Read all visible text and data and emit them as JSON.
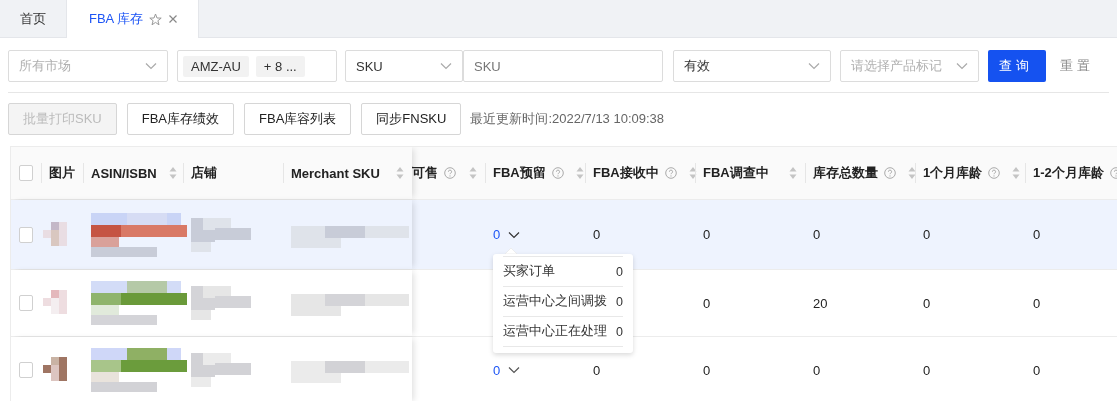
{
  "tabs": [
    {
      "label": "首页",
      "selected": false,
      "closable": false
    },
    {
      "label": "FBA 库存",
      "selected": true,
      "closable": true
    }
  ],
  "filters": [
    {
      "kind": "select",
      "placeholder": "所有市场"
    },
    {
      "kind": "tags",
      "tags": [
        "AMZ-AU",
        "+ 8 ..."
      ]
    },
    {
      "kind": "select",
      "value": "SKU"
    },
    {
      "kind": "input",
      "placeholder": "SKU"
    },
    {
      "kind": "select",
      "value": "有效"
    },
    {
      "kind": "select",
      "placeholder": "请选择产品标记"
    }
  ],
  "search_button": "查询",
  "reset_button": "重置",
  "actions": [
    {
      "label": "批量打印SKU",
      "disabled": true
    },
    {
      "label": "FBA库存绩效",
      "disabled": false
    },
    {
      "label": "FBA库容列表",
      "disabled": false
    },
    {
      "label": "同步FNSKU",
      "disabled": false
    }
  ],
  "last_updated": "最近更新时间:2022/7/13 10:09:38",
  "table": {
    "select_all_checked": false,
    "fixed_columns": [
      {
        "label": "图片",
        "sortable": false
      },
      {
        "label": "ASIN/ISBN",
        "sortable": true
      },
      {
        "label": "店铺",
        "sortable": false
      },
      {
        "label": "Merchant SKU",
        "sortable": true
      }
    ],
    "columns": [
      {
        "label": "可售",
        "help": true,
        "sortable": true
      },
      {
        "label": "FBA预留",
        "help": true,
        "sortable": true
      },
      {
        "label": "FBA接收中",
        "help": true,
        "sortable": true
      },
      {
        "label": "FBA调查中",
        "help": false,
        "sortable": true
      },
      {
        "label": "库存总数量",
        "help": true,
        "sortable": true
      },
      {
        "label": "1个月库龄",
        "help": true,
        "sortable": true
      },
      {
        "label": "1-2个月库龄",
        "help": true,
        "sortable": false
      }
    ],
    "rows": [
      {
        "selected": true,
        "checked": false,
        "cells": [
          null,
          {
            "text": "0",
            "dropdown": true,
            "expanded": true,
            "details": [
              {
                "label": "买家订单",
                "value": "0"
              },
              {
                "label": "运营中心之间调拨",
                "value": "0"
              },
              {
                "label": "运营中心正在处理",
                "value": "0"
              }
            ]
          },
          {
            "text": "0"
          },
          {
            "text": "0"
          },
          {
            "text": "0"
          },
          {
            "text": "0"
          },
          {
            "text": "0"
          }
        ]
      },
      {
        "selected": false,
        "checked": false,
        "cells": [
          null,
          null,
          null,
          {
            "text": "0"
          },
          {
            "text": "20"
          },
          {
            "text": "0"
          },
          {
            "text": "0"
          }
        ]
      },
      {
        "selected": false,
        "checked": false,
        "cells": [
          null,
          {
            "text": "0",
            "dropdown": true,
            "expanded": false
          },
          {
            "text": "0"
          },
          {
            "text": "0"
          },
          {
            "text": "0"
          },
          {
            "text": "0"
          },
          {
            "text": "0"
          }
        ]
      }
    ]
  }
}
